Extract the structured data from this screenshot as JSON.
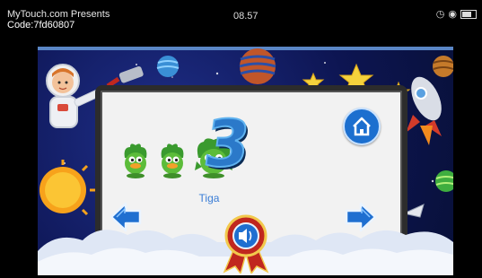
{
  "status_bar": {
    "overlay_title": "MyTouch.com Presents",
    "overlay_code": "Code:7fd60807",
    "time": "08.57",
    "icons": [
      "alarm-icon",
      "eye-icon",
      "battery-icon"
    ],
    "battery_level": 0.6
  },
  "lesson": {
    "number_digit": "3",
    "word_label": "Tiga",
    "item_count": 3,
    "item_icon": "duck-icon"
  },
  "controls": {
    "home": "home-icon",
    "previous": "left-arrow-icon",
    "next": "right-arrow-icon",
    "sound": "speaker-icon"
  },
  "colors": {
    "accent_blue": "#1c6fcf",
    "space_bg": "#0d1552",
    "board_bg": "#f2f2f2",
    "badge_red": "#c0271f"
  }
}
